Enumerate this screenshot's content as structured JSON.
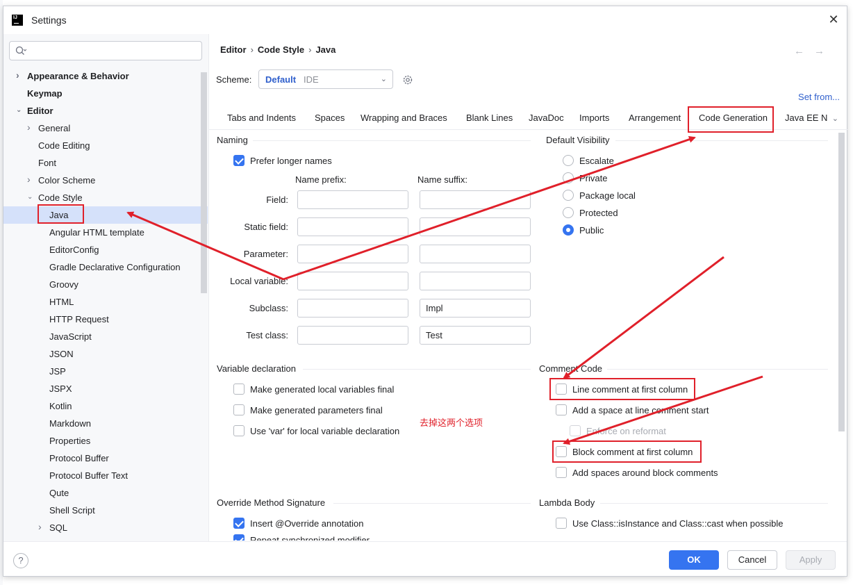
{
  "window": {
    "title": "Settings",
    "app_icon_text": "IJ"
  },
  "sidebar": {
    "search_placeholder": "",
    "items": [
      {
        "label": "Appearance & Behavior",
        "level": 0,
        "bold": true,
        "expander": "collapsed"
      },
      {
        "label": "Keymap",
        "level": 0,
        "bold": true,
        "expander": "none"
      },
      {
        "label": "Editor",
        "level": 0,
        "bold": true,
        "expander": "expanded"
      },
      {
        "label": "General",
        "level": 1,
        "bold": false,
        "expander": "collapsed"
      },
      {
        "label": "Code Editing",
        "level": 1,
        "bold": false,
        "expander": "none"
      },
      {
        "label": "Font",
        "level": 1,
        "bold": false,
        "expander": "none"
      },
      {
        "label": "Color Scheme",
        "level": 1,
        "bold": false,
        "expander": "collapsed"
      },
      {
        "label": "Code Style",
        "level": 1,
        "bold": false,
        "expander": "expanded"
      },
      {
        "label": "Java",
        "level": 2,
        "bold": false,
        "expander": "none",
        "selected": true
      },
      {
        "label": "Angular HTML template",
        "level": 2,
        "bold": false,
        "expander": "none"
      },
      {
        "label": "EditorConfig",
        "level": 2,
        "bold": false,
        "expander": "none"
      },
      {
        "label": "Gradle Declarative Configuration",
        "level": 2,
        "bold": false,
        "expander": "none"
      },
      {
        "label": "Groovy",
        "level": 2,
        "bold": false,
        "expander": "none"
      },
      {
        "label": "HTML",
        "level": 2,
        "bold": false,
        "expander": "none"
      },
      {
        "label": "HTTP Request",
        "level": 2,
        "bold": false,
        "expander": "none"
      },
      {
        "label": "JavaScript",
        "level": 2,
        "bold": false,
        "expander": "none"
      },
      {
        "label": "JSON",
        "level": 2,
        "bold": false,
        "expander": "none"
      },
      {
        "label": "JSP",
        "level": 2,
        "bold": false,
        "expander": "none"
      },
      {
        "label": "JSPX",
        "level": 2,
        "bold": false,
        "expander": "none"
      },
      {
        "label": "Kotlin",
        "level": 2,
        "bold": false,
        "expander": "none"
      },
      {
        "label": "Markdown",
        "level": 2,
        "bold": false,
        "expander": "none"
      },
      {
        "label": "Properties",
        "level": 2,
        "bold": false,
        "expander": "none"
      },
      {
        "label": "Protocol Buffer",
        "level": 2,
        "bold": false,
        "expander": "none"
      },
      {
        "label": "Protocol Buffer Text",
        "level": 2,
        "bold": false,
        "expander": "none"
      },
      {
        "label": "Qute",
        "level": 2,
        "bold": false,
        "expander": "none"
      },
      {
        "label": "Shell Script",
        "level": 2,
        "bold": false,
        "expander": "none"
      },
      {
        "label": "SQL",
        "level": 2,
        "bold": false,
        "expander": "collapsed"
      }
    ]
  },
  "breadcrumb": [
    "Editor",
    "Code Style",
    "Java"
  ],
  "scheme": {
    "label": "Scheme:",
    "value": "Default",
    "suffix": "IDE",
    "set_from": "Set from..."
  },
  "tabs": [
    "Tabs and Indents",
    "Spaces",
    "Wrapping and Braces",
    "Blank Lines",
    "JavaDoc",
    "Imports",
    "Arrangement",
    "Code Generation",
    "Java EE N"
  ],
  "active_tab": "Code Generation",
  "naming": {
    "title": "Naming",
    "prefer_longer_names": {
      "label": "Prefer longer names",
      "checked": true
    },
    "prefix_header": "Name prefix:",
    "suffix_header": "Name suffix:",
    "rows": [
      {
        "label": "Field:",
        "prefix": "",
        "suffix": ""
      },
      {
        "label": "Static field:",
        "prefix": "",
        "suffix": ""
      },
      {
        "label": "Parameter:",
        "prefix": "",
        "suffix": ""
      },
      {
        "label": "Local variable:",
        "prefix": "",
        "suffix": ""
      },
      {
        "label": "Subclass:",
        "prefix": "",
        "suffix": "Impl"
      },
      {
        "label": "Test class:",
        "prefix": "",
        "suffix": "Test"
      }
    ]
  },
  "default_visibility": {
    "title": "Default Visibility",
    "options": [
      "Escalate",
      "Private",
      "Package local",
      "Protected",
      "Public"
    ],
    "selected": "Public"
  },
  "variable_declaration": {
    "title": "Variable declaration",
    "options": [
      {
        "label": "Make generated local variables final",
        "checked": false
      },
      {
        "label": "Make generated parameters final",
        "checked": false
      },
      {
        "label": "Use 'var' for local variable declaration",
        "checked": false
      }
    ]
  },
  "comment_code": {
    "title": "Comment Code",
    "options": [
      {
        "label": "Line comment at first column",
        "checked": false,
        "enabled": true
      },
      {
        "label": "Add a space at line comment start",
        "checked": false,
        "enabled": true
      },
      {
        "label": "Enforce on reformat",
        "checked": false,
        "enabled": false
      },
      {
        "label": "Block comment at first column",
        "checked": false,
        "enabled": true
      },
      {
        "label": "Add spaces around block comments",
        "checked": false,
        "enabled": true
      }
    ]
  },
  "annotation_text": "去掉这两个选项",
  "override_method_signature": {
    "title": "Override Method Signature",
    "options": [
      {
        "label": "Insert @Override annotation",
        "checked": true
      },
      {
        "label": "Repeat synchronized modifier",
        "checked": true
      }
    ]
  },
  "lambda_body": {
    "title": "Lambda Body",
    "options": [
      {
        "label": "Use Class::isInstance and Class::cast when possible",
        "checked": false
      }
    ]
  },
  "footer": {
    "help": "?",
    "ok": "OK",
    "cancel": "Cancel",
    "apply": "Apply"
  },
  "colors": {
    "accent": "#3574f0",
    "annotation_red": "#e0202a",
    "selection": "#d5e1fa"
  }
}
